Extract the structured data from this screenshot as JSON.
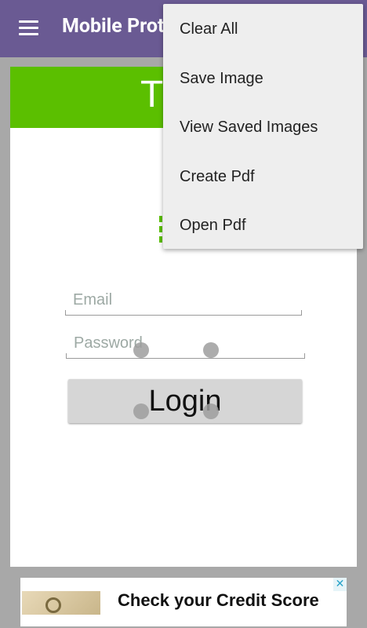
{
  "app_bar": {
    "title": "Mobile Prot",
    "menu_icon": "hamburger-menu-icon"
  },
  "canvas": {
    "banner_text": "T",
    "email_placeholder": "Email",
    "password_placeholder": "Password",
    "login_label": "Login"
  },
  "overflow_menu": {
    "items": [
      {
        "label": "Clear All"
      },
      {
        "label": "Save Image"
      },
      {
        "label": "View Saved Images"
      },
      {
        "label": "Create Pdf"
      },
      {
        "label": "Open Pdf"
      }
    ]
  },
  "ad": {
    "text": "Check your Credit Score",
    "close_icon": "close-icon",
    "close_glyph": "✕"
  },
  "colors": {
    "app_bar": "#6a5a93",
    "banner": "#5bbf00",
    "background": "#a8a8a8",
    "menu": "#eeeeee"
  }
}
